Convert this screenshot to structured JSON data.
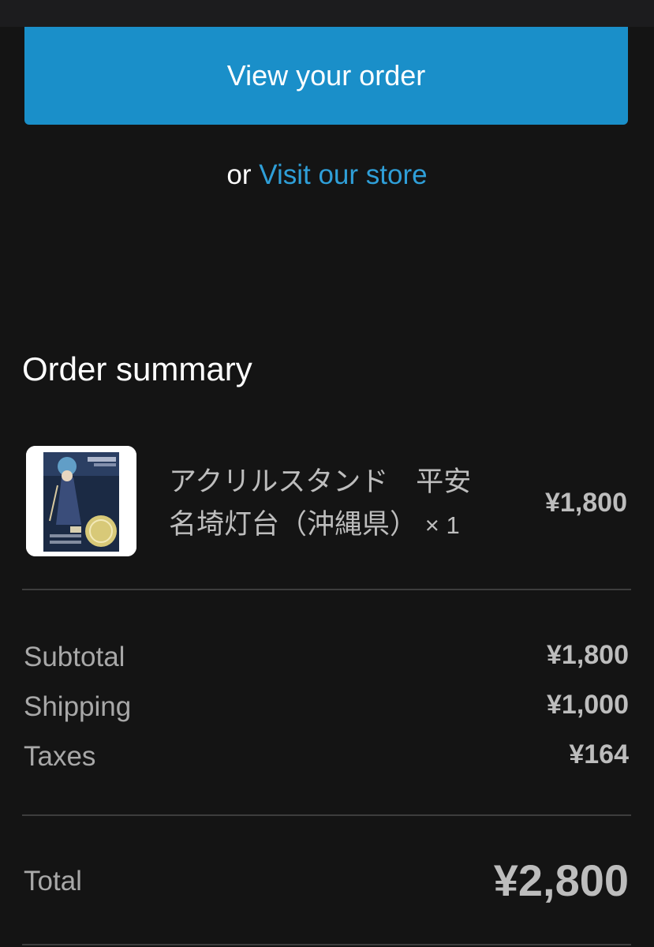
{
  "actions": {
    "view_order_label": "View your order",
    "or_text": "or",
    "visit_store_label": "Visit our store"
  },
  "summary": {
    "title": "Order summary",
    "item": {
      "name_line1": "アクリルスタンド　平安",
      "name_line2": "名埼灯台（沖縄県）",
      "quantity": "× 1",
      "price": "¥1,800"
    },
    "subtotal_label": "Subtotal",
    "subtotal_value": "¥1,800",
    "shipping_label": "Shipping",
    "shipping_value": "¥1,000",
    "taxes_label": "Taxes",
    "taxes_value": "¥164",
    "total_label": "Total",
    "total_value": "¥2,800"
  },
  "colors": {
    "background": "#141414",
    "accent": "#1a8fc9",
    "link": "#2f9fd8"
  }
}
